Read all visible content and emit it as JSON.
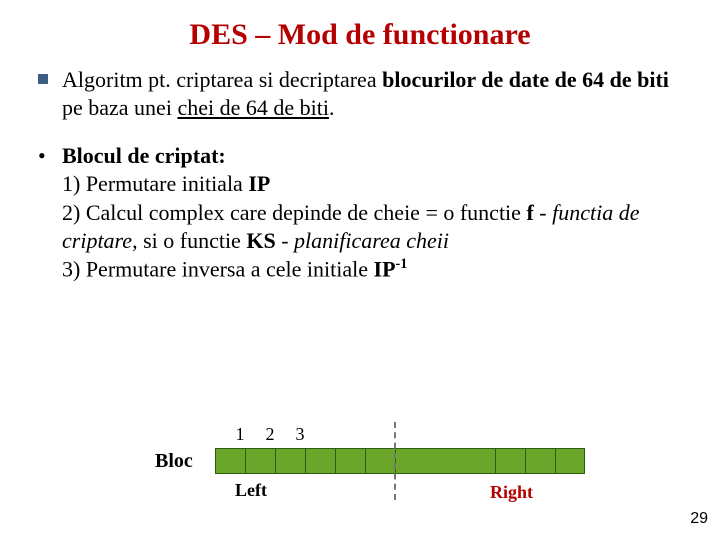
{
  "title": "DES – Mod de functionare",
  "p1": {
    "pre": "Algoritm pt. criptarea si decriptarea ",
    "b1": "blocurilor de date de 64 de biti",
    "mid": " pe baza unei ",
    "u1": "chei de 64 de biti",
    "post": "."
  },
  "p2": {
    "head": "Blocul de criptat:",
    "l1a": "1) Permutare initiala ",
    "l1b": "IP",
    "l2a": "2) Calcul complex care depinde de cheie = o functie ",
    "l2b": "f",
    "l2c": " - ",
    "l2d": "functia de criptare",
    "l2e": ", si o functie ",
    "l2f": "KS",
    "l2g": " - ",
    "l2h": "planificarea cheii",
    "l3a": "3) Permutare inversa a cele initiale ",
    "l3b": "IP",
    "l3sup": "-1"
  },
  "diagram": {
    "bloc": "Bloc",
    "n1": "1",
    "n2": "2",
    "n3": "3",
    "left": "Left",
    "right": "Right"
  },
  "pagenum": "29"
}
